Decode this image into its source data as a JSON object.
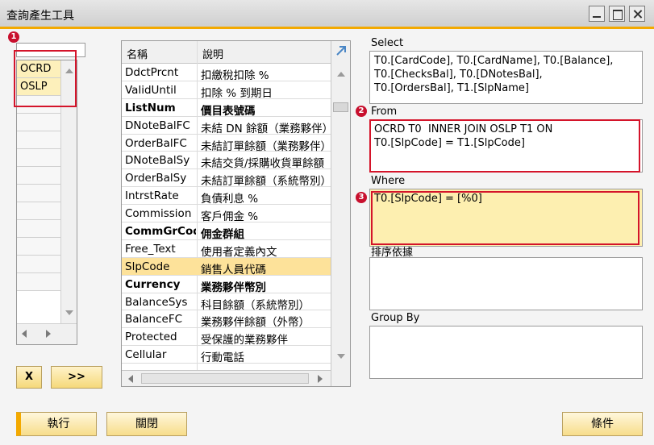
{
  "window": {
    "title": "查詢產生工具"
  },
  "markers": [
    "1",
    "2",
    "3"
  ],
  "tables": {
    "search_value": "",
    "items": [
      "OCRD",
      "OSLP"
    ]
  },
  "buttons": {
    "remove": "X",
    "add": ">>",
    "execute": "執行",
    "close": "關閉",
    "conditions": "條件"
  },
  "fields": {
    "columns": [
      "名稱",
      "說明"
    ],
    "rows": [
      {
        "name": "DdctPrcnt",
        "desc": "扣繳稅扣除 %",
        "bold": false,
        "selected": false
      },
      {
        "name": "ValidUntil",
        "desc": "扣除 % 到期日",
        "bold": false,
        "selected": false
      },
      {
        "name": "ListNum",
        "desc": "價目表號碼",
        "bold": true,
        "selected": false
      },
      {
        "name": "DNoteBalFC",
        "desc": "未結 DN 餘額（業務夥伴）",
        "bold": false,
        "selected": false
      },
      {
        "name": "OrderBalFC",
        "desc": "未結訂單餘額（業務夥伴）",
        "bold": false,
        "selected": false
      },
      {
        "name": "DNoteBalSy",
        "desc": "未結交貨/採購收貨單餘額",
        "bold": false,
        "selected": false
      },
      {
        "name": "OrderBalSy",
        "desc": "未結訂單餘額（系統幣別）",
        "bold": false,
        "selected": false
      },
      {
        "name": "IntrstRate",
        "desc": "負債利息 %",
        "bold": false,
        "selected": false
      },
      {
        "name": "Commission",
        "desc": "客戶佣金 %",
        "bold": false,
        "selected": false
      },
      {
        "name": "CommGrCode",
        "desc": "佣金群組",
        "bold": true,
        "selected": false
      },
      {
        "name": "Free_Text",
        "desc": "使用者定義內文",
        "bold": false,
        "selected": false
      },
      {
        "name": "SlpCode",
        "desc": "銷售人員代碼",
        "bold": false,
        "selected": true
      },
      {
        "name": "Currency",
        "desc": "業務夥伴幣別",
        "bold": true,
        "selected": false
      },
      {
        "name": "BalanceSys",
        "desc": "科目餘額（系統幣別）",
        "bold": false,
        "selected": false
      },
      {
        "name": "BalanceFC",
        "desc": "業務夥伴餘額（外幣）",
        "bold": false,
        "selected": false
      },
      {
        "name": "Protected",
        "desc": "受保護的業務夥伴",
        "bold": false,
        "selected": false
      },
      {
        "name": "Cellular",
        "desc": "行動電話",
        "bold": false,
        "selected": false
      }
    ]
  },
  "query": {
    "select_label": "Select",
    "select_text": "T0.[CardCode], T0.[CardName], T0.[Balance],\nT0.[ChecksBal], T0.[DNotesBal],\nT0.[OrdersBal], T1.[SlpName]",
    "from_label": "From",
    "from_text": "OCRD T0  INNER JOIN OSLP T1 ON\nT0.[SlpCode] = T1.[SlpCode]",
    "where_label": "Where",
    "where_text": "T0.[SlpCode] = [%0]",
    "orderby_label": "排序依據",
    "orderby_text": "",
    "groupby_label": "Group By",
    "groupby_text": ""
  },
  "colors": {
    "accent": "#f3a900",
    "highlight": "#d4142a",
    "selected_row": "#fde29a"
  }
}
